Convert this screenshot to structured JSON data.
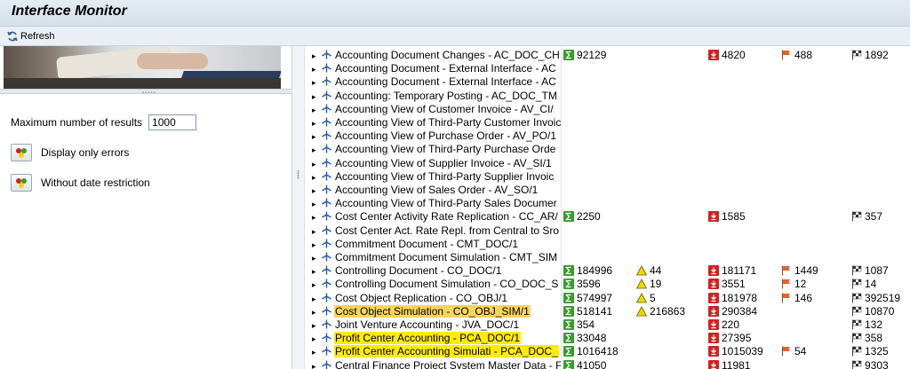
{
  "window": {
    "title": "Interface Monitor"
  },
  "toolbar": {
    "refresh_label": "Refresh"
  },
  "filters": {
    "max_results_label": "Maximum number of results",
    "max_results_value": "1000",
    "display_errors_label": "Display only errors",
    "no_date_label": "Without date restriction"
  },
  "colors": {
    "success": "#3a9a2f",
    "warning": "#f2d600",
    "error": "#d42020",
    "flag": "#e0622b",
    "highlight": "#f7d55b",
    "highlight_marker": "#ffec00"
  },
  "rows": [
    {
      "name": "Accounting Document Changes - AC_DOC_CH",
      "success": "92129",
      "warning": "",
      "error": "4820",
      "flag": "488",
      "total": "1892",
      "hl": ""
    },
    {
      "name": "Accounting Document - External Interface - AC",
      "success": "",
      "warning": "",
      "error": "",
      "flag": "",
      "total": "",
      "hl": ""
    },
    {
      "name": "Accounting Document - External Interface - AC",
      "success": "",
      "warning": "",
      "error": "",
      "flag": "",
      "total": "",
      "hl": ""
    },
    {
      "name": "Accounting: Temporary Posting - AC_DOC_TM",
      "success": "",
      "warning": "",
      "error": "",
      "flag": "",
      "total": "",
      "hl": ""
    },
    {
      "name": "Accounting View of Customer Invoice - AV_CI/",
      "success": "",
      "warning": "",
      "error": "",
      "flag": "",
      "total": "",
      "hl": ""
    },
    {
      "name": "Accounting View of Third-Party Customer Invoic",
      "success": "",
      "warning": "",
      "error": "",
      "flag": "",
      "total": "",
      "hl": ""
    },
    {
      "name": "Accounting View of Purchase Order - AV_PO/1",
      "success": "",
      "warning": "",
      "error": "",
      "flag": "",
      "total": "",
      "hl": ""
    },
    {
      "name": "Accounting View of Third-Party Purchase Orde",
      "success": "",
      "warning": "",
      "error": "",
      "flag": "",
      "total": "",
      "hl": ""
    },
    {
      "name": "Accounting View of Supplier Invoice - AV_SI/1",
      "success": "",
      "warning": "",
      "error": "",
      "flag": "",
      "total": "",
      "hl": ""
    },
    {
      "name": "Accounting View of Third-Party Supplier Invoic",
      "success": "",
      "warning": "",
      "error": "",
      "flag": "",
      "total": "",
      "hl": ""
    },
    {
      "name": "Accounting View of Sales Order - AV_SO/1",
      "success": "",
      "warning": "",
      "error": "",
      "flag": "",
      "total": "",
      "hl": ""
    },
    {
      "name": "Accounting View of Third-Party Sales Documer",
      "success": "",
      "warning": "",
      "error": "",
      "flag": "",
      "total": "",
      "hl": ""
    },
    {
      "name": "Cost Center Activity Rate Replication - CC_AR/",
      "success": "2250",
      "warning": "",
      "error": "1585",
      "flag": "",
      "total": "357",
      "hl": ""
    },
    {
      "name": "Cost Center Act. Rate Repl. from Central to Sro",
      "success": "",
      "warning": "",
      "error": "",
      "flag": "",
      "total": "",
      "hl": ""
    },
    {
      "name": "Commitment Document - CMT_DOC/1",
      "success": "",
      "warning": "",
      "error": "",
      "flag": "",
      "total": "",
      "hl": ""
    },
    {
      "name": "Commitment Document Simulation - CMT_SIM",
      "success": "",
      "warning": "",
      "error": "",
      "flag": "",
      "total": "",
      "hl": ""
    },
    {
      "name": "Controlling Document - CO_DOC/1",
      "success": "184996",
      "warning": "44",
      "error": "181171",
      "flag": "1449",
      "total": "1087",
      "hl": ""
    },
    {
      "name": "Controlling Document Simulation - CO_DOC_S",
      "success": "3596",
      "warning": "19",
      "error": "3551",
      "flag": "12",
      "total": "14",
      "hl": ""
    },
    {
      "name": "Cost Object Replication - CO_OBJ/1",
      "success": "574997",
      "warning": "5",
      "error": "181978",
      "flag": "146",
      "total": "392519",
      "hl": ""
    },
    {
      "name": "Cost Object Simulation - CO_OBJ_SIM/1",
      "success": "518141",
      "warning": "216863",
      "error": "290384",
      "flag": "",
      "total": "10870",
      "hl": "box"
    },
    {
      "name": "Joint Venture Accounting - JVA_DOC/1",
      "success": "354",
      "warning": "",
      "error": "220",
      "flag": "",
      "total": "132",
      "hl": ""
    },
    {
      "name": "Profit Center Accounting - PCA_DOC/1",
      "success": "33048",
      "warning": "",
      "error": "27395",
      "flag": "",
      "total": "358",
      "hl": "marker"
    },
    {
      "name": "Profit Center Accounting Simulati - PCA_DOC_",
      "success": "1016418",
      "warning": "",
      "error": "1015039",
      "flag": "54",
      "total": "1325",
      "hl": "marker"
    },
    {
      "name": "Central Finance Project System Master Data - F",
      "success": "41050",
      "warning": "",
      "error": "11981",
      "flag": "",
      "total": "9303",
      "hl": ""
    }
  ]
}
